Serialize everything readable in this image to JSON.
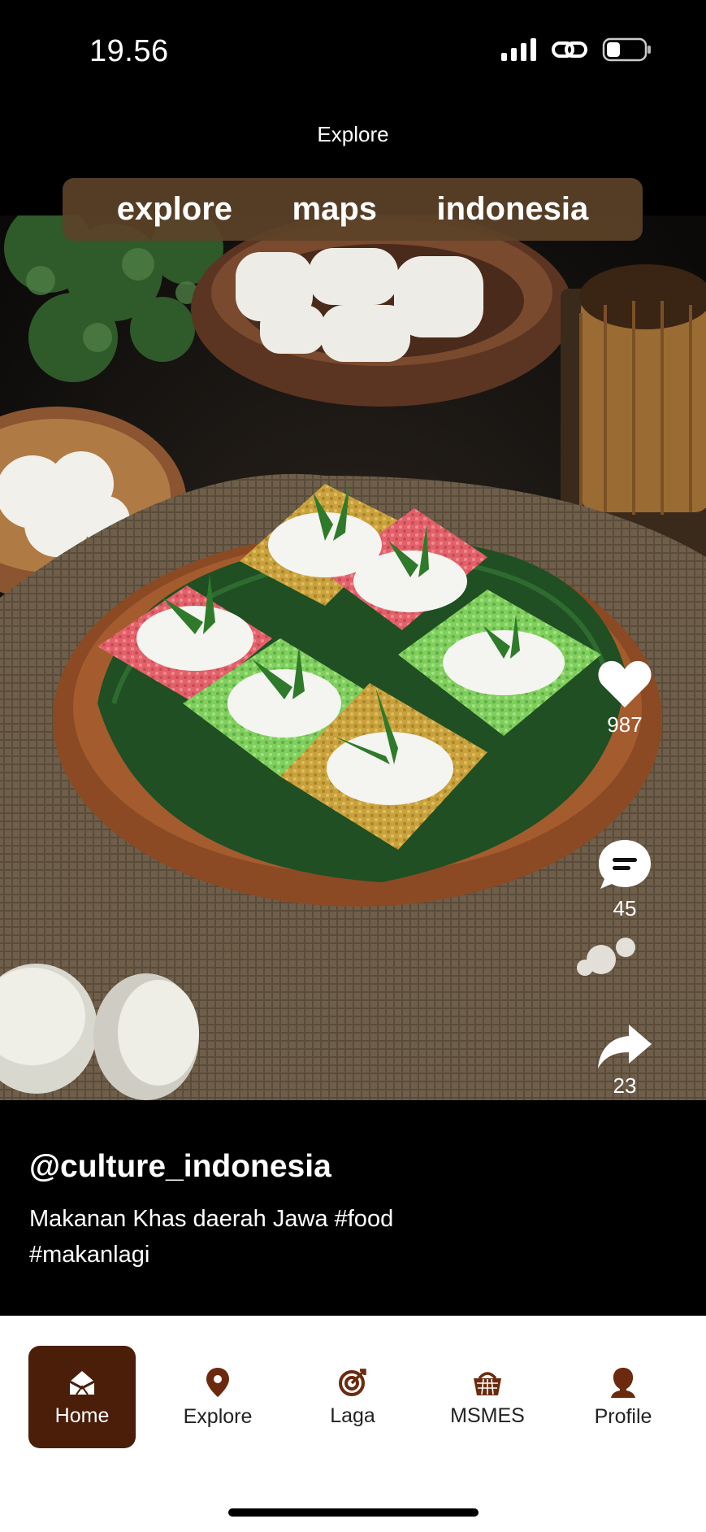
{
  "status_bar": {
    "time": "19.56"
  },
  "header": {
    "title": "Explore"
  },
  "tabs": [
    {
      "label": "explore"
    },
    {
      "label": "maps"
    },
    {
      "label": "indonesia"
    }
  ],
  "actions": {
    "likes": "987",
    "comments": "45",
    "shares": "23"
  },
  "post": {
    "username": "@culture_indonesia",
    "caption": "Makanan Khas daerah Jawa #food #makanlagi"
  },
  "nav": {
    "items": [
      {
        "label": "Home",
        "icon": "home-icon",
        "active": true
      },
      {
        "label": "Explore",
        "icon": "location-pin-icon"
      },
      {
        "label": "Laga",
        "icon": "target-icon"
      },
      {
        "label": "MSMES",
        "icon": "basket-icon"
      },
      {
        "label": "Profile",
        "icon": "person-icon"
      }
    ]
  },
  "colors": {
    "nav_active_bg": "#4a1e09",
    "tab_bar_bg": "#5c4228",
    "icon_brown": "#6b2a0e"
  }
}
